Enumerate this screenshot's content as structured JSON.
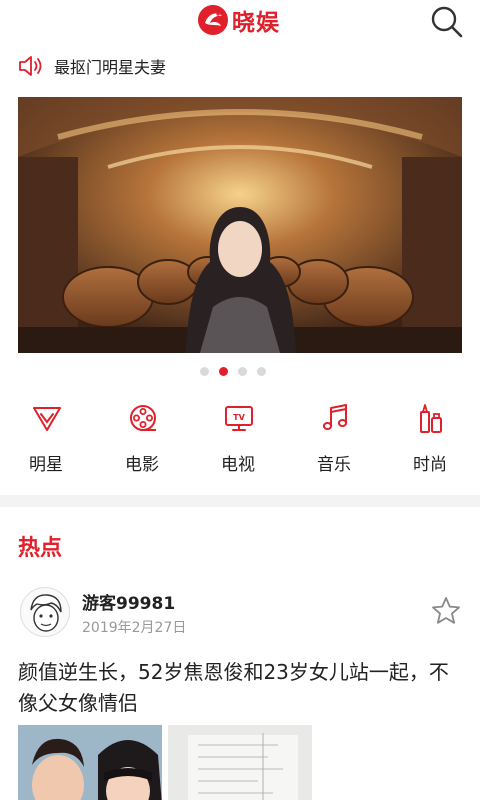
{
  "app": {
    "name": "晓娱"
  },
  "colors": {
    "accent": "#e0202b",
    "muted": "#999999",
    "separator": "#f3f3f3"
  },
  "ticker": {
    "icon": "speaker-icon",
    "text": "最抠门明星夫妻"
  },
  "carousel": {
    "slide_count": 4,
    "active_index": 1
  },
  "nav": [
    {
      "label": "明星",
      "icon": "star-diamond-icon"
    },
    {
      "label": "电影",
      "icon": "film-reel-icon"
    },
    {
      "label": "电视",
      "icon": "tv-icon"
    },
    {
      "label": "音乐",
      "icon": "music-note-icon"
    },
    {
      "label": "时尚",
      "icon": "lipstick-icon"
    }
  ],
  "section": {
    "title": "热点"
  },
  "post": {
    "username": "游客99981",
    "date": "2019年2月27日",
    "title": "颜值逆生长，52岁焦恩俊和23岁女儿站一起，不像父女像情侣"
  }
}
